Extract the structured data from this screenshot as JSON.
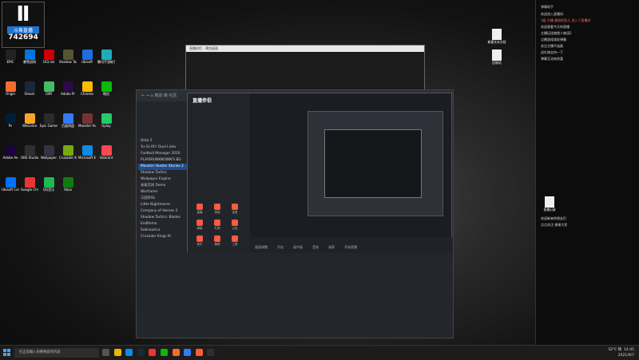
{
  "stream_logo": {
    "text": "Ⅱ",
    "bar": "斗鱼直播",
    "viewer_count": "742694"
  },
  "desktop_icons": [
    {
      "label": "EPIC",
      "color": "#222"
    },
    {
      "label": "暴雪战网",
      "color": "#0074e0"
    },
    {
      "label": "163.lnk",
      "color": "#c00"
    },
    {
      "label": "Shadow Tactics",
      "color": "#553"
    },
    {
      "label": "Ubisoft",
      "color": "#1b6fe0"
    },
    {
      "label": "腾讯手游助手",
      "color": "#2ab"
    },
    {
      "label": "Origin",
      "color": "#f56c2d"
    },
    {
      "label": "Steam",
      "color": "#1b2838"
    },
    {
      "label": "IDM",
      "color": "#4b6"
    },
    {
      "label": "Adobe Pr",
      "color": "#2a0a4a"
    },
    {
      "label": "Chrome",
      "color": "#fbbc04"
    },
    {
      "label": "微信",
      "color": "#09bb07"
    },
    {
      "label": "Ps",
      "color": "#001e36"
    },
    {
      "label": "WeGame",
      "color": "#f5a623"
    },
    {
      "label": "Epic Games",
      "color": "#2a2a2a"
    },
    {
      "label": "百度网盘",
      "color": "#2f7bf5"
    },
    {
      "label": "Monster Hunter",
      "color": "#733"
    },
    {
      "label": "Uplay",
      "color": "#2c6"
    },
    {
      "label": "Adobe Ae",
      "color": "#1f0040"
    },
    {
      "label": "OBS Studio",
      "color": "#302e31"
    },
    {
      "label": "Wallpaper",
      "color": "#334"
    },
    {
      "label": "Crusader Kings III",
      "color": "#7a1"
    },
    {
      "label": "Microsoft Edge",
      "color": "#0c8ce9"
    },
    {
      "label": "Valorant",
      "color": "#ff4655"
    },
    {
      "label": "Ubisoft Connect",
      "color": "#0070ff"
    },
    {
      "label": "Google Chrome",
      "color": "#e33"
    },
    {
      "label": "QQ音乐",
      "color": "#1db954"
    },
    {
      "label": "Xbox",
      "color": "#107c10"
    }
  ],
  "small_window": {
    "title": "直播伴侣 - 预览画面"
  },
  "big_window": {
    "nav": "← → ⌂ 商店 库 社区",
    "list_items": [
      "Dota 2",
      "Yu-Gi-Oh! Duel Links",
      "Football Manager 2020",
      "PLAYERUNKNOWN'S BG",
      "Monster Hunter Stories 2",
      "Shadow Tactics",
      "Wallpaper Engine",
      "永劫无间 Demo",
      "Warframe",
      "三国杀OL",
      "Little Nightmares",
      "Company of Heroes 2",
      "Shadow Tactics: Blades",
      "EndRemo",
      "Subnautica",
      "Crusader Kings III"
    ],
    "highlight_index": 4
  },
  "cc_window": {
    "brand": "直播伴侣",
    "tools": [
      "直播",
      "录制",
      "连麦",
      "弹幕",
      "礼物",
      "公告",
      "音乐",
      "美颜",
      "工具"
    ],
    "bottom": [
      "画面调整",
      "开启",
      "画中画",
      "音效",
      "录屏",
      "开始直播"
    ]
  },
  "right_panel": {
    "header": "弹幕助手",
    "lines": [
      "欢迎进入直播间",
      "1级 主播 美丽的鱼儿 进入了直播间",
      "欢迎观看今天的直播",
      "主播玩怪物猎人物语2",
      "点播游戏请发弹幕",
      "关注主播不迷路",
      "送礼物支持一下",
      "弹幕互动有惊喜"
    ],
    "footer_lines": [
      "欢迎新来的朋友们",
      "点点关注 谢谢大家"
    ]
  },
  "right_icons": [
    {
      "label": "新建文本文档"
    },
    {
      "label": "回收站"
    },
    {
      "label": "直播记录"
    }
  ],
  "taskbar": {
    "search_placeholder": "在这里输入你要搜索的内容",
    "time": "14:45",
    "date": "2021/9/7",
    "weather": "32°C 晴"
  }
}
